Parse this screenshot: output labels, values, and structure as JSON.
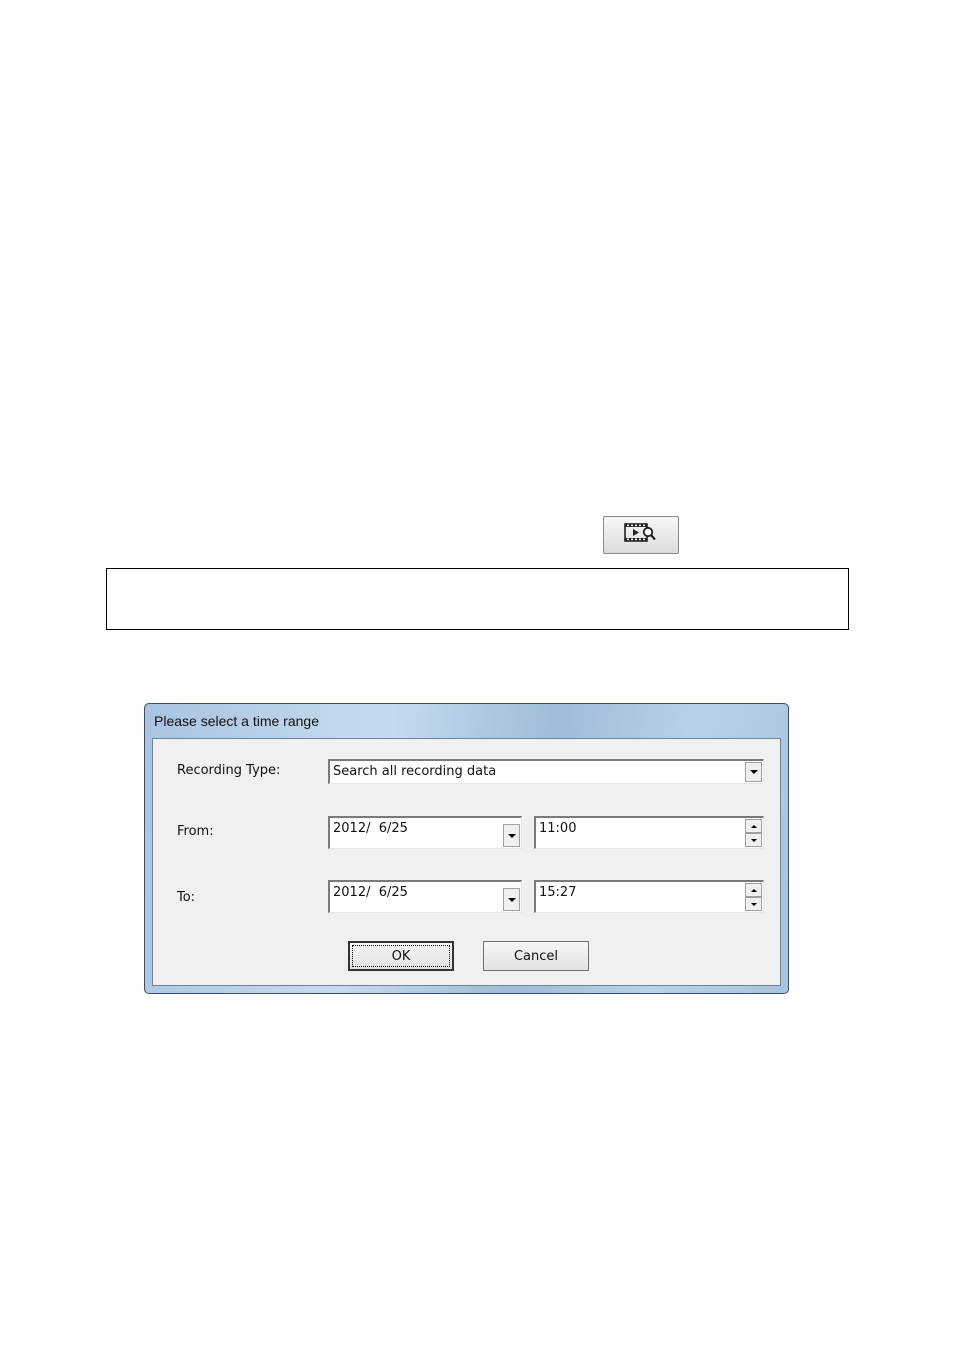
{
  "toolbar": {
    "search_button_icon": "video-search-icon"
  },
  "dialog": {
    "title": "Please select a time range",
    "recording_type": {
      "label": "Recording Type:",
      "value": "Search all recording data"
    },
    "from": {
      "label": "From:",
      "date": "2012/  6/25",
      "time": "11:00"
    },
    "to": {
      "label": "To:",
      "date": "2012/  6/25",
      "time": "15:27"
    },
    "buttons": {
      "ok": "OK",
      "cancel": "Cancel"
    }
  }
}
